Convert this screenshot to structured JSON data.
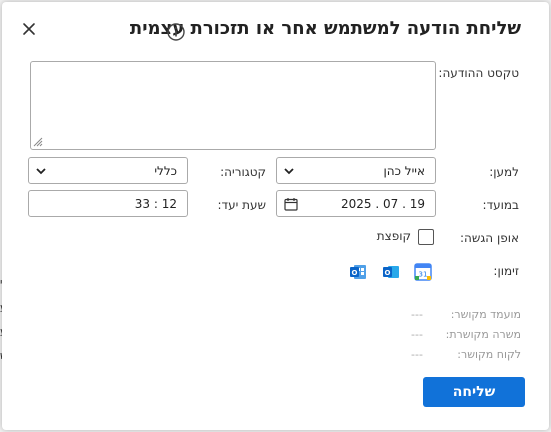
{
  "dialog": {
    "title": "שליחת הודעה למשתמש אחר או תזכורת עצמית"
  },
  "form": {
    "message_label": "טקסט ההודעה:",
    "message_value": "",
    "to_label": "למען:",
    "to_value": "אייל כהן",
    "category_label": "קטגוריה:",
    "category_value": "כללי",
    "date_label": "במועד:",
    "date_value": "19 . 07 . 2025",
    "time_label": "שעת יעד:",
    "time_value": "12 : 33",
    "delivery_label": "אופן הגשה:",
    "popup_label": "קופצת",
    "popup_checked": false,
    "invite_label": "זימון:"
  },
  "calendar_apps": [
    {
      "icon": "google-calendar-icon",
      "day": "31"
    },
    {
      "icon": "outlook-icon",
      "letter": "O"
    },
    {
      "icon": "outlook-calendar-icon",
      "letter": "O"
    }
  ],
  "related": {
    "event_label": "מועמד מקושר:",
    "event_value": "---",
    "job_label": "משרה מקושרת:",
    "job_value": "---",
    "customer_label": "לקוח מקושר:",
    "customer_value": "---"
  },
  "actions": {
    "send_label": "שליחה"
  },
  "colors": {
    "primary": "#1172d9",
    "border": "#aaaaaa",
    "muted": "#999999"
  }
}
